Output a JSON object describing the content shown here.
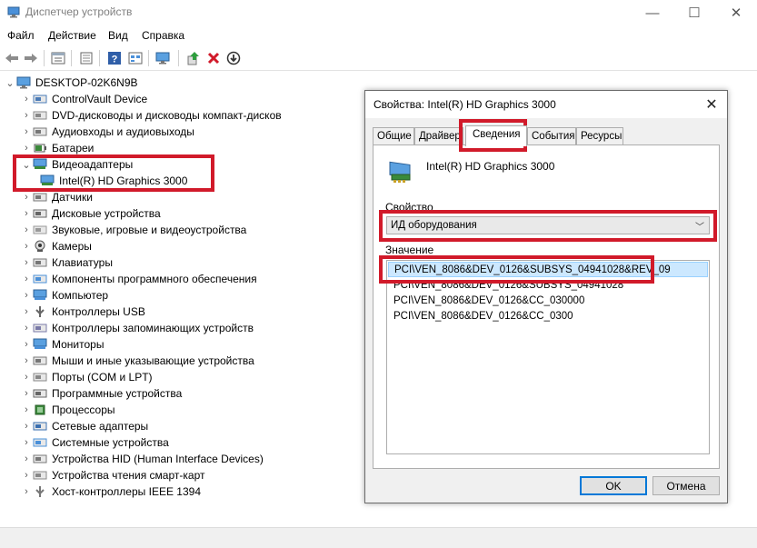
{
  "window": {
    "title": "Диспетчер устройств",
    "minimize_glyph": "—",
    "maximize_glyph": "☐",
    "close_glyph": "✕"
  },
  "menu": [
    "Файл",
    "Действие",
    "Вид",
    "Справка"
  ],
  "toolbar_icons": [
    "back-icon",
    "forward-icon",
    "show-hide-icon",
    "properties-icon",
    "help-icon",
    "view-icon",
    "monitor-scan-icon",
    "update-driver-icon",
    "uninstall-icon",
    "disable-icon"
  ],
  "tree": {
    "root": "DESKTOP-02K6N9B",
    "items": [
      {
        "label": "ControlVault Device",
        "icon": "chip-icon"
      },
      {
        "label": "DVD-дисководы и дисководы компакт-дисков",
        "icon": "dvd-drive-icon"
      },
      {
        "label": "Аудиовходы и аудиовыходы",
        "icon": "speaker-icon"
      },
      {
        "label": "Батареи",
        "icon": "battery-icon"
      },
      {
        "label": "Видеоадаптеры",
        "icon": "display-adapter-icon",
        "expanded": true
      },
      {
        "label": "Intel(R) HD Graphics 3000",
        "icon": "display-adapter-icon",
        "child": true
      },
      {
        "label": "Датчики",
        "icon": "sensor-icon"
      },
      {
        "label": "Дисковые устройства",
        "icon": "disk-drive-icon"
      },
      {
        "label": "Звуковые, игровые и видеоустройства",
        "icon": "sound-icon"
      },
      {
        "label": "Камеры",
        "icon": "camera-icon"
      },
      {
        "label": "Клавиатуры",
        "icon": "keyboard-icon"
      },
      {
        "label": "Компоненты программного обеспечения",
        "icon": "software-component-icon"
      },
      {
        "label": "Компьютер",
        "icon": "computer-icon"
      },
      {
        "label": "Контроллеры USB",
        "icon": "usb-icon"
      },
      {
        "label": "Контроллеры запоминающих устройств",
        "icon": "storage-controller-icon"
      },
      {
        "label": "Мониторы",
        "icon": "monitor-icon"
      },
      {
        "label": "Мыши и иные указывающие устройства",
        "icon": "mouse-icon"
      },
      {
        "label": "Порты (COM и LPT)",
        "icon": "port-icon"
      },
      {
        "label": "Программные устройства",
        "icon": "software-device-icon"
      },
      {
        "label": "Процессоры",
        "icon": "processor-icon"
      },
      {
        "label": "Сетевые адаптеры",
        "icon": "network-adapter-icon"
      },
      {
        "label": "Системные устройства",
        "icon": "system-device-icon"
      },
      {
        "label": "Устройства HID (Human Interface Devices)",
        "icon": "hid-icon"
      },
      {
        "label": "Устройства чтения смарт-карт",
        "icon": "smartcard-reader-icon"
      },
      {
        "label": "Хост-контроллеры IEEE 1394",
        "icon": "ieee1394-icon"
      }
    ]
  },
  "dialog": {
    "title": "Свойства: Intel(R) HD Graphics 3000",
    "close_glyph": "✕",
    "tabs": [
      "Общие",
      "Драйвер",
      "Сведения",
      "События",
      "Ресурсы"
    ],
    "active_tab": "Сведения",
    "device_name": "Intel(R) HD Graphics 3000",
    "property_label": "Свойство",
    "property_value": "ИД оборудования",
    "value_label": "Значение",
    "values": [
      "PCI\\VEN_8086&DEV_0126&SUBSYS_04941028&REV_09",
      "PCI\\VEN_8086&DEV_0126&SUBSYS_04941028",
      "PCI\\VEN_8086&DEV_0126&CC_030000",
      "PCI\\VEN_8086&DEV_0126&CC_0300"
    ],
    "ok_label": "OK",
    "cancel_label": "Отмена"
  },
  "colors": {
    "highlight_border": "#d11a2a",
    "selection_bg": "#cce8ff",
    "accent": "#0078d7"
  }
}
